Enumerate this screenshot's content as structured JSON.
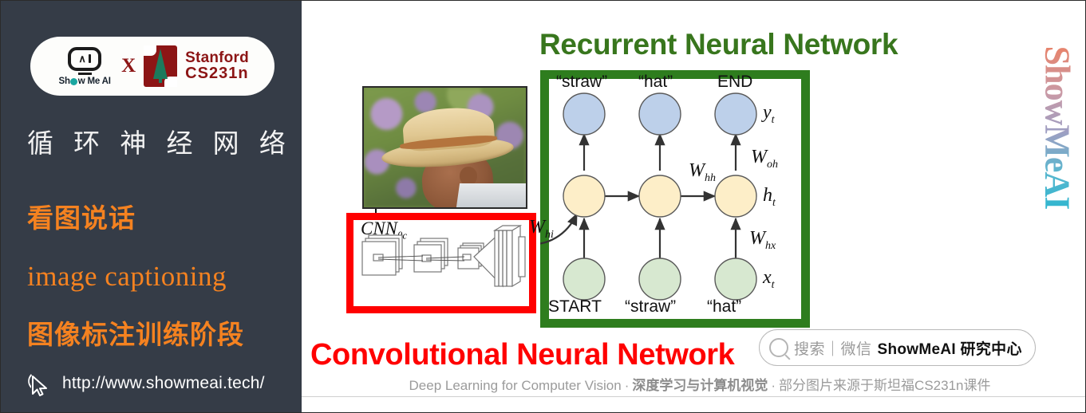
{
  "sidebar": {
    "badge": {
      "smai_word": "Show Me AI",
      "x_label": "X",
      "stanford_line1": "Stanford",
      "stanford_line2": "CS231n"
    },
    "title_cn": "循 环 神 经 网 络",
    "subtitle_cn": "看图说话",
    "subtitle_en": "image captioning",
    "stage_cn": "图像标注训练阶段",
    "url": "http://www.showmeai.tech/",
    "colors": {
      "background": "#353C47",
      "accent_orange": "#F58220",
      "text_white": "#FFFFFF",
      "stanford_red": "#8C1515"
    }
  },
  "main": {
    "rnn_title": "Recurrent Neural Network",
    "cnn_title": "Convolutional Neural Network",
    "cnn_box": {
      "label": "CNN",
      "label_sub": "θc"
    },
    "rnn_diagram": {
      "output_labels": [
        "“straw”",
        "“hat”",
        "END"
      ],
      "input_labels": [
        "START",
        "“straw”",
        "“hat”"
      ],
      "weight_labels": [
        "W",
        "W",
        "W",
        "W"
      ],
      "weight_hh": "W",
      "weight_hh_sub": "hh",
      "weight_oh": "W",
      "weight_oh_sub": "oh",
      "weight_hx": "W",
      "weight_hx_sub": "hx",
      "weight_hi": "W",
      "weight_hi_sub": "hi",
      "state_y": "y",
      "state_y_sub": "t",
      "state_h": "h",
      "state_h_sub": "t",
      "state_x": "x",
      "state_x_sub": "t",
      "node_colors": {
        "output": "#bdd0ea",
        "hidden": "#fdeec8",
        "input": "#d7e8d0"
      }
    },
    "colors": {
      "rnn_green": "#38761D",
      "rnn_border_green": "#2E7D1E",
      "cnn_red": "#FF0000"
    }
  },
  "watermark": {
    "text": "ShowMeAI"
  },
  "search_badge": {
    "gray_text": "搜索｜微信",
    "dark_text": "ShowMeAI 研究中心"
  },
  "footer": {
    "en": "Deep Learning for Computer Vision",
    "sep1": "·",
    "cn_bold": "深度学习与计算机视觉",
    "sep2": "·",
    "cn_note": "部分图片来源于斯坦福CS231n课件"
  }
}
